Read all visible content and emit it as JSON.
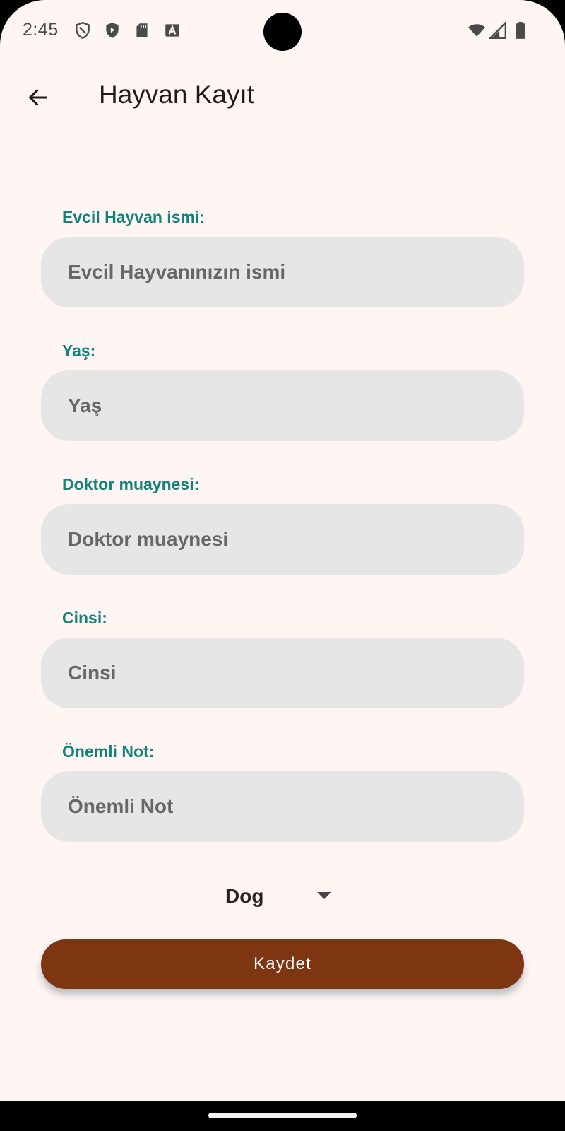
{
  "status_bar": {
    "time": "2:45",
    "icons": [
      "shield-outline-icon",
      "play-protect-icon",
      "sd-card-icon",
      "font-a-icon",
      "wifi-icon",
      "cellular-signal-icon",
      "battery-icon"
    ]
  },
  "app_bar": {
    "back_icon": "arrow-left-icon",
    "title": "Hayvan Kayıt"
  },
  "form": {
    "pet_name": {
      "label": "Evcil Hayvan ismi:",
      "placeholder": "Evcil Hayvanınızın ismi",
      "value": ""
    },
    "age": {
      "label": "Yaş:",
      "placeholder": "Yaş",
      "value": ""
    },
    "vet_exam": {
      "label": "Doktor muaynesi:",
      "placeholder": "Doktor muaynesi",
      "value": ""
    },
    "breed": {
      "label": "Cinsi:",
      "placeholder": "Cinsi",
      "value": ""
    },
    "note": {
      "label": "Önemli Not:",
      "placeholder": "Önemli Not",
      "value": ""
    },
    "species_dropdown": {
      "selected": "Dog",
      "icon": "caret-down-icon"
    },
    "save_label": "Kaydet"
  },
  "colors": {
    "background": "#fff5f3",
    "label": "#12827c",
    "input_fill": "#e6e6e6",
    "button": "#7e3512"
  }
}
